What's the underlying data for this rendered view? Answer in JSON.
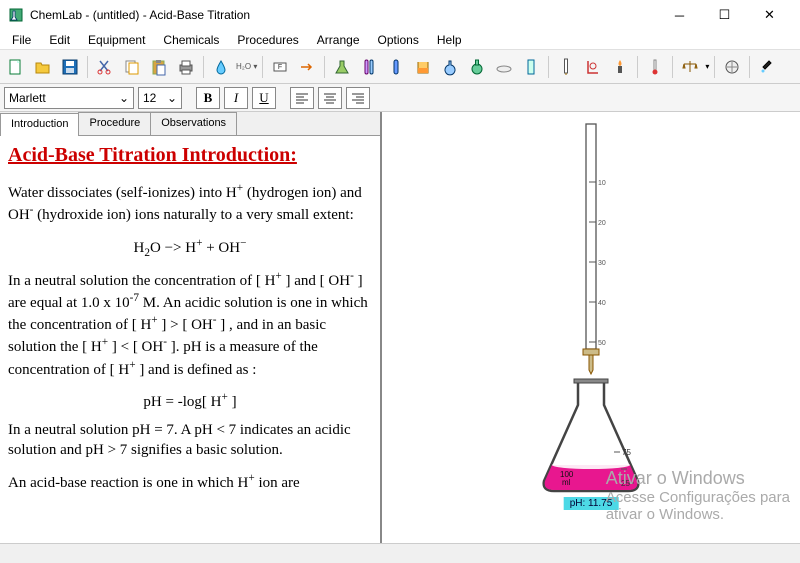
{
  "window": {
    "title": "ChemLab - (untitled) - Acid-Base Titration"
  },
  "menu": [
    "File",
    "Edit",
    "Equipment",
    "Chemicals",
    "Procedures",
    "Arrange",
    "Options",
    "Help"
  ],
  "format": {
    "font": "Marlett",
    "size": "12"
  },
  "tabs": [
    "Introduction",
    "Procedure",
    "Observations"
  ],
  "content": {
    "heading": "Acid-Base Titration Introduction:",
    "p1a": "Water dissociates (self-ionizes) into H",
    "p1b": " (hydrogen ion) and OH",
    "p1c": " (hydroxide ion) ions naturally to a very small extent:",
    "eq1a": "H",
    "eq1b": "O    −>    H",
    "eq1c": "    +      OH",
    "p2a": "In a neutral solution the concentration of [ H",
    "p2b": " ] and [ OH",
    "p2c": " ] are equal at 1.0 x 10",
    "p2d": " M. An acidic solution is one in which the concentration of [ H",
    "p2e": " ] > [ OH",
    "p2f": " ] , and in an basic solution the [ H",
    "p2g": " ] < [ OH",
    "p2h": " ]. pH is a measure of the concentration of [ H",
    "p2i": " ] and is defined as :",
    "eq2a": "pH = -log[ H",
    "eq2b": " ]",
    "p3": "In a neutral solution pH = 7. A pH < 7 indicates an acidic solution and pH > 7 signifies a basic solution.",
    "p4a": "An acid-base reaction is one in which H",
    "p4b": " ion are"
  },
  "lab": {
    "ph_label": "pH: 11.75",
    "flask_vol": "100",
    "flask_unit": "ml",
    "flask_mark": "25",
    "burette_marks": [
      "10",
      "20",
      "30",
      "40",
      "50"
    ]
  },
  "watermark": {
    "line1": "Ativar o Windows",
    "line2": "Acesse Configurações para",
    "line3": "ativar o Windows."
  }
}
